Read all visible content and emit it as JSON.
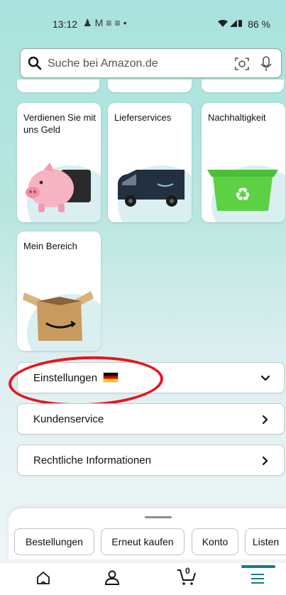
{
  "status_bar": {
    "time": "13:12",
    "notification_icons": [
      "person-icon",
      "mail-icon",
      "translate-icon",
      "translate-icon",
      "dot-icon"
    ],
    "battery": "86 %"
  },
  "search": {
    "placeholder": "Suche bei Amazon.de"
  },
  "cards": [
    {
      "label": "Verdienen Sie mit uns Geld",
      "image": "piggy-bank-icon"
    },
    {
      "label": "Lieferservices",
      "image": "delivery-van-icon"
    },
    {
      "label": "Nachhaltigkeit",
      "image": "recycle-bin-icon"
    },
    {
      "label": "Mein Bereich",
      "image": "amazon-box-icon"
    }
  ],
  "rows": [
    {
      "label": "Einstellungen",
      "flag": "de-flag-icon",
      "chevron": "chevron-down-icon"
    },
    {
      "label": "Kundenservice",
      "chevron": "chevron-right-icon"
    },
    {
      "label": "Rechtliche Informationen",
      "chevron": "chevron-right-icon"
    }
  ],
  "quick_chips": [
    "Bestellungen",
    "Erneut kaufen",
    "Konto",
    "Listen"
  ],
  "bottom_nav": {
    "items": [
      "home-icon",
      "profile-icon",
      "cart-icon",
      "menu-icon"
    ],
    "cart_count": "0",
    "active": "menu-icon"
  },
  "colors": {
    "accent": "#1a7a8c",
    "highlight": "#e8141b"
  }
}
